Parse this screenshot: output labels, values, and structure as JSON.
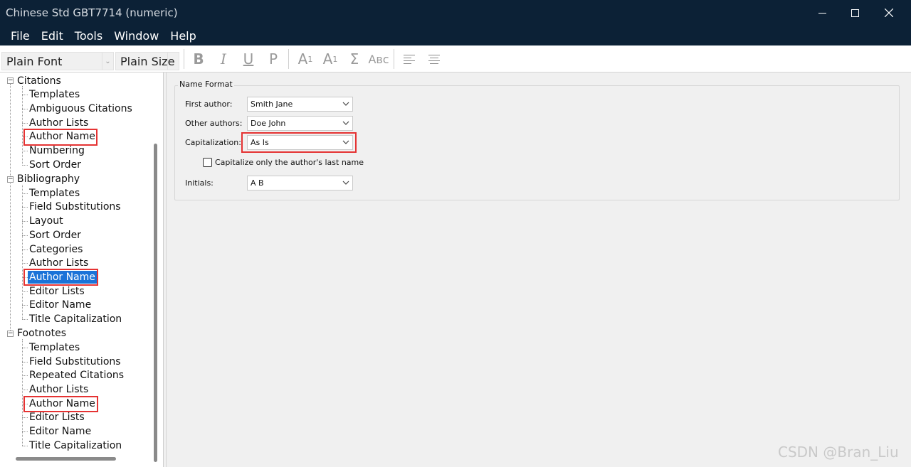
{
  "window": {
    "title": "Chinese Std GBT7714 (numeric)"
  },
  "menu": [
    "File",
    "Edit",
    "Tools",
    "Window",
    "Help"
  ],
  "toolbar": {
    "font": "Plain Font",
    "size": "Plain Size",
    "bold": "B",
    "italic": "I",
    "underline": "U",
    "plain": "P",
    "superscript_base": "A",
    "superscript_mark": "1",
    "subscript_base": "A",
    "subscript_mark": "1",
    "symbol": "Σ",
    "smallcaps": "Aʙᴄ"
  },
  "tree": {
    "sections": [
      {
        "label": "Citations",
        "items": [
          "Templates",
          "Ambiguous Citations",
          "Author Lists",
          "Author Name",
          "Numbering",
          "Sort Order"
        ]
      },
      {
        "label": "Bibliography",
        "items": [
          "Templates",
          "Field Substitutions",
          "Layout",
          "Sort Order",
          "Categories",
          "Author Lists",
          "Author Name",
          "Editor Lists",
          "Editor Name",
          "Title Capitalization"
        ]
      },
      {
        "label": "Footnotes",
        "items": [
          "Templates",
          "Field Substitutions",
          "Repeated Citations",
          "Author Lists",
          "Author Name",
          "Editor Lists",
          "Editor Name",
          "Title Capitalization"
        ]
      }
    ],
    "selected": "Bibliography > Author Name"
  },
  "form": {
    "group_title": "Name Format",
    "first_author_label": "First author:",
    "first_author_value": "Smith Jane",
    "other_authors_label": "Other authors:",
    "other_authors_value": "Doe John",
    "capitalization_label": "Capitalization:",
    "capitalization_value": "As Is",
    "capitalize_last_only_label": "Capitalize only the author's last name",
    "capitalize_last_only_checked": false,
    "initials_label": "Initials:",
    "initials_value": "A B"
  },
  "watermark": "CSDN @Bran_Liu",
  "colors": {
    "titlebar": "#0c2136",
    "highlight": "#e53333",
    "selection": "#1a73d8"
  }
}
